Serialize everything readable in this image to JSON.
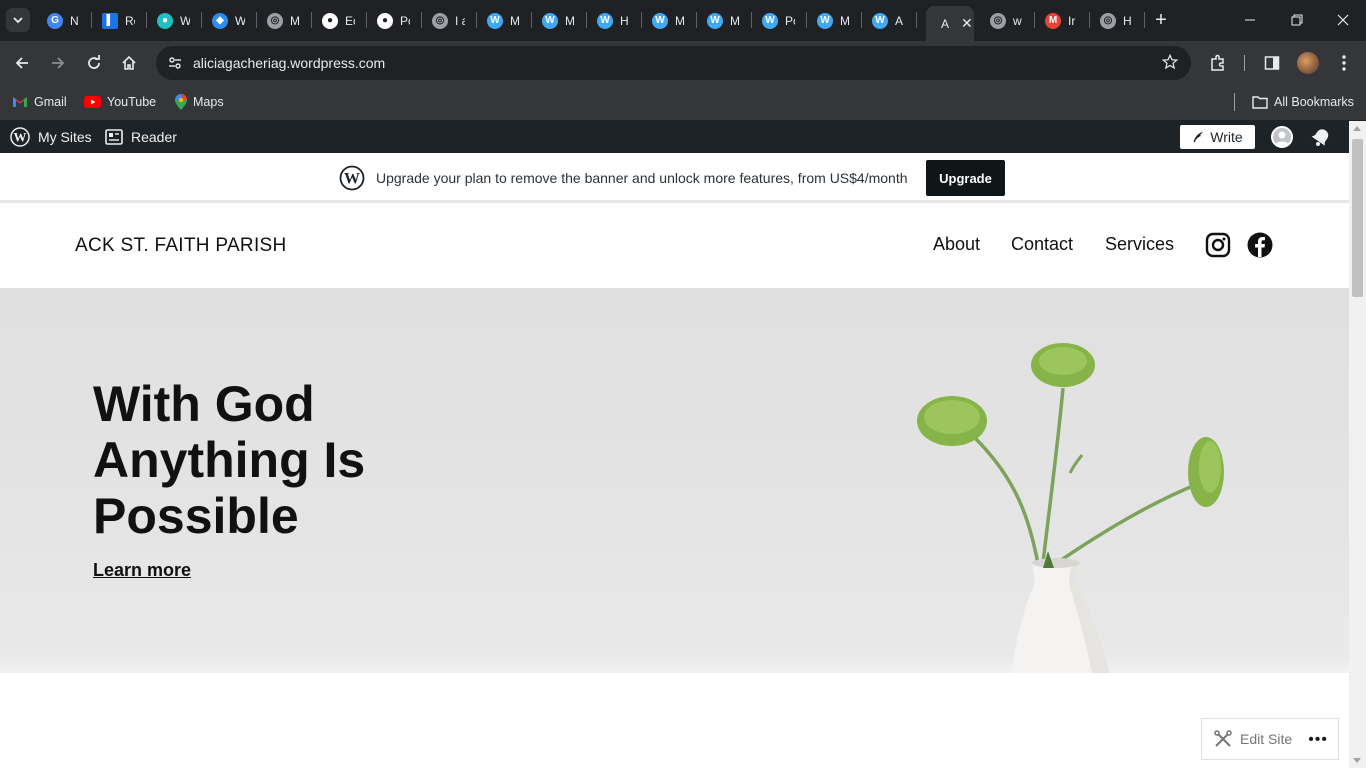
{
  "browser": {
    "tabs": [
      {
        "title": "N",
        "icon": "google-icon",
        "color": "#4285f4"
      },
      {
        "title": "Re",
        "icon": "doc-icon",
        "color": "#1a73e8"
      },
      {
        "title": "W",
        "icon": "circle-icon",
        "color": "#21c0c0"
      },
      {
        "title": "W",
        "icon": "diamond-icon",
        "color": "#2d8cf0"
      },
      {
        "title": "M",
        "icon": "globe-icon",
        "color": "#9aa0a6"
      },
      {
        "title": "Ec",
        "icon": "github-icon",
        "color": "#ffffff"
      },
      {
        "title": "Pc",
        "icon": "github-icon",
        "color": "#ffffff"
      },
      {
        "title": "I a",
        "icon": "globe-icon",
        "color": "#9aa0a6"
      },
      {
        "title": "M",
        "icon": "wordpress-icon",
        "color": "#3fa9f5"
      },
      {
        "title": "M",
        "icon": "wordpress-icon",
        "color": "#3fa9f5"
      },
      {
        "title": "H",
        "icon": "wordpress-icon",
        "color": "#3fa9f5"
      },
      {
        "title": "M",
        "icon": "wordpress-icon",
        "color": "#3fa9f5"
      },
      {
        "title": "M",
        "icon": "wordpress-icon",
        "color": "#3fa9f5"
      },
      {
        "title": "Pc",
        "icon": "wordpress-icon",
        "color": "#3fa9f5"
      },
      {
        "title": "M",
        "icon": "wordpress-icon",
        "color": "#3fa9f5"
      },
      {
        "title": "A",
        "icon": "wordpress-icon",
        "color": "#3fa9f5"
      }
    ],
    "active_tab": {
      "title": "A"
    },
    "tabs_after": [
      {
        "title": "w",
        "icon": "globe-icon",
        "color": "#9aa0a6"
      },
      {
        "title": "Ir",
        "icon": "gmail-icon",
        "color": "#ea4335"
      },
      {
        "title": "H",
        "icon": "globe-icon",
        "color": "#9aa0a6"
      }
    ],
    "url": "aliciagacheriag.wordpress.com",
    "bookmarks": [
      {
        "label": "Gmail"
      },
      {
        "label": "YouTube"
      },
      {
        "label": "Maps"
      }
    ],
    "all_bookmarks": "All Bookmarks"
  },
  "wp_admin_bar": {
    "my_sites": "My Sites",
    "reader": "Reader",
    "write": "Write"
  },
  "banner": {
    "message": "Upgrade your plan to remove the banner and unlock more features, from US$4/month",
    "button": "Upgrade"
  },
  "site": {
    "title": "ACK ST. FAITH PARISH",
    "nav": [
      "About",
      "Contact",
      "Services"
    ]
  },
  "hero": {
    "line1": "With God",
    "line2": "Anything Is",
    "line3": "Possible",
    "link": "Learn more"
  },
  "edit_site": {
    "label": "Edit Site",
    "more": "•••"
  }
}
